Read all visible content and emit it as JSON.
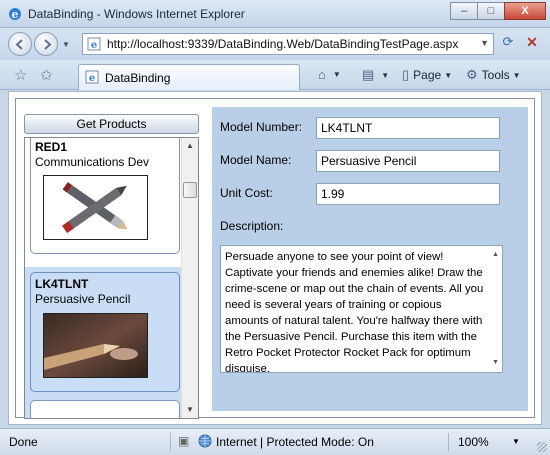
{
  "window": {
    "title": "DataBinding - Windows Internet Explorer",
    "controls": [
      "–",
      "□",
      "X"
    ]
  },
  "address": {
    "url": "http://localhost:9339/DataBinding.Web/DataBindingTestPage.aspx"
  },
  "tabs": [
    {
      "label": "DataBinding"
    }
  ],
  "commands": {
    "home_icon": "home-icon",
    "print_icon": "printer-icon",
    "page_label": "Page",
    "tools_label": "Tools"
  },
  "app": {
    "get_products_label": "Get Products",
    "products": [
      {
        "model_number": "RED1",
        "model_name": "Communications Dev",
        "image": "crossed-pens"
      },
      {
        "model_number": "LK4TLNT",
        "model_name": "Persuasive Pencil",
        "image": "pencil-closeup",
        "selected": true
      }
    ],
    "detail": {
      "model_number_label": "Model Number:",
      "model_number": "LK4TLNT",
      "model_name_label": "Model Name:",
      "model_name": "Persuasive Pencil",
      "unit_cost_label": "Unit Cost:",
      "unit_cost": "1.99",
      "description_label": "Description:",
      "description": "Persuade anyone to see your point of view! Captivate your friends and enemies alike! Draw the crime-scene or map out the chain of events.  All you need is several years of training or copious amounts of natural talent. You're halfway there with the Persuasive Pencil. Purchase this item with the Retro Pocket Protector Rocket Pack for optimum disguise."
    }
  },
  "status": {
    "text": "Done",
    "zone": "Internet | Protected Mode: On",
    "zoom": "100%"
  },
  "colors": {
    "detail_background": "#b9cfe7",
    "selected_item": "#c9def4"
  }
}
